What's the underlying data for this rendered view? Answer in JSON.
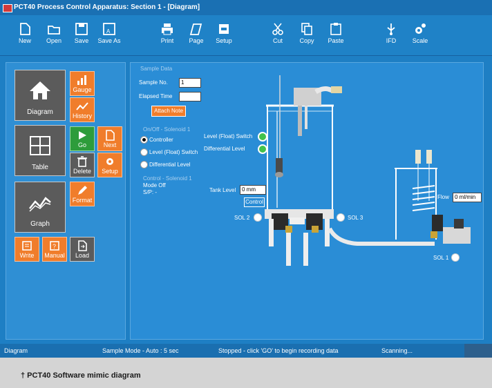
{
  "window": {
    "title": "PCT40 Process Control Apparatus: Section 1 - [Diagram]"
  },
  "toolbar": {
    "new": "New",
    "open": "Open",
    "save": "Save",
    "save_as": "Save As",
    "print": "Print",
    "page": "Page",
    "setup": "Setup",
    "cut": "Cut",
    "copy": "Copy",
    "paste": "Paste",
    "ifd": "IFD",
    "scale": "Scale"
  },
  "left_panel": {
    "diagram": "Diagram",
    "gauge": "Gauge",
    "history": "History",
    "table": "Table",
    "go": "Go",
    "next": "Next",
    "delete": "Delete",
    "setup": "Setup",
    "graph": "Graph",
    "format": "Format",
    "write": "Write",
    "manual": "Manual",
    "load": "Load"
  },
  "sample_data": {
    "heading": "Sample Data",
    "sample_no_label": "Sample No.",
    "sample_no_value": "1",
    "elapsed_time_label": "Elapsed Time",
    "elapsed_time_value": "",
    "attach_note": "Attach Note"
  },
  "solenoid": {
    "heading": "On/Off - Solenoid 1",
    "options": [
      "Controller",
      "Level (Float) Switch",
      "Differential Level"
    ],
    "selected": "Controller",
    "control_heading": "Control - Solenoid 1",
    "mode": "Mode Off",
    "sp": "S/P:    -"
  },
  "indicators": {
    "float_switch": "Level (Float) Switch",
    "differential_level": "Differential Level"
  },
  "tank": {
    "level_label": "Tank Level",
    "level_value": "0 mm",
    "control_button": "Control"
  },
  "flow": {
    "label": "Flow",
    "value": "0 ml/min"
  },
  "sols": {
    "sol1": "SOL 1",
    "sol2": "SOL 2",
    "sol3": "SOL 3"
  },
  "status": {
    "view": "Diagram",
    "sample_mode": "Sample Mode - Auto : 5 sec",
    "message": "Stopped - click 'GO' to begin recording data",
    "scanning": "Scanning..."
  },
  "caption": "† PCT40 Software mimic diagram",
  "colors": {
    "background": "#1e7fc4",
    "orange": "#f07d2b",
    "led_green": "#42c24c"
  }
}
